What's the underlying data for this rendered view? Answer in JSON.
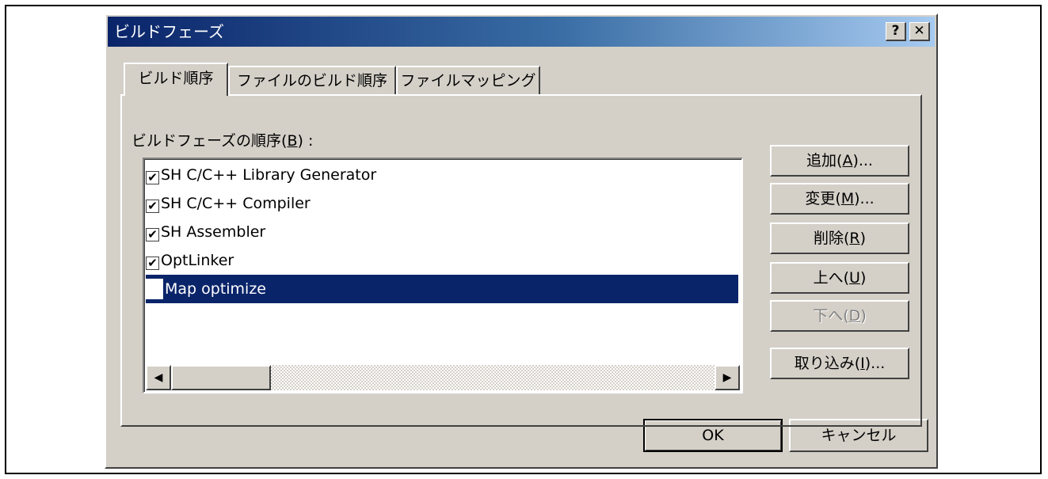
{
  "dialog": {
    "title": "ビルドフェーズ",
    "help_label": "?",
    "close_label": "✕"
  },
  "tabs": [
    {
      "label": "ビルド順序",
      "active": true
    },
    {
      "label": "ファイルのビルド順序",
      "active": false
    },
    {
      "label": "ファイルマッピング",
      "active": false
    }
  ],
  "group": {
    "label_prefix": "ビルドフェーズの順序(",
    "label_mnemonic": "B",
    "label_suffix": ") :"
  },
  "phases": [
    {
      "label": "SH C/C++ Library Generator",
      "checked": true,
      "selected": false
    },
    {
      "label": "SH C/C++ Compiler",
      "checked": true,
      "selected": false
    },
    {
      "label": "SH Assembler",
      "checked": true,
      "selected": false
    },
    {
      "label": "OptLinker",
      "checked": true,
      "selected": false
    },
    {
      "label": "Map optimize",
      "checked": false,
      "selected": true
    }
  ],
  "checkmark_glyph": "✔",
  "scroll": {
    "left_arrow": "◀",
    "right_arrow": "▶"
  },
  "side_buttons": {
    "add": {
      "prefix": "追加(",
      "mnemonic": "A",
      "suffix": ")..."
    },
    "modify": {
      "prefix": "変更(",
      "mnemonic": "M",
      "suffix": ")..."
    },
    "remove": {
      "prefix": "削除(",
      "mnemonic": "R",
      "suffix": ")"
    },
    "up": {
      "prefix": "上へ(",
      "mnemonic": "U",
      "suffix": ")"
    },
    "down": {
      "prefix": "下へ(",
      "mnemonic": "D",
      "suffix": ")",
      "disabled": true
    },
    "import": {
      "prefix": "取り込み(",
      "mnemonic": "I",
      "suffix": ")..."
    }
  },
  "footer": {
    "ok_label": "OK",
    "cancel_label": "キャンセル"
  },
  "colors": {
    "dialog_face": "#d4d0c8",
    "titlebar_start": "#0a246a",
    "titlebar_end": "#a6caf0",
    "selection": "#0a246a"
  }
}
